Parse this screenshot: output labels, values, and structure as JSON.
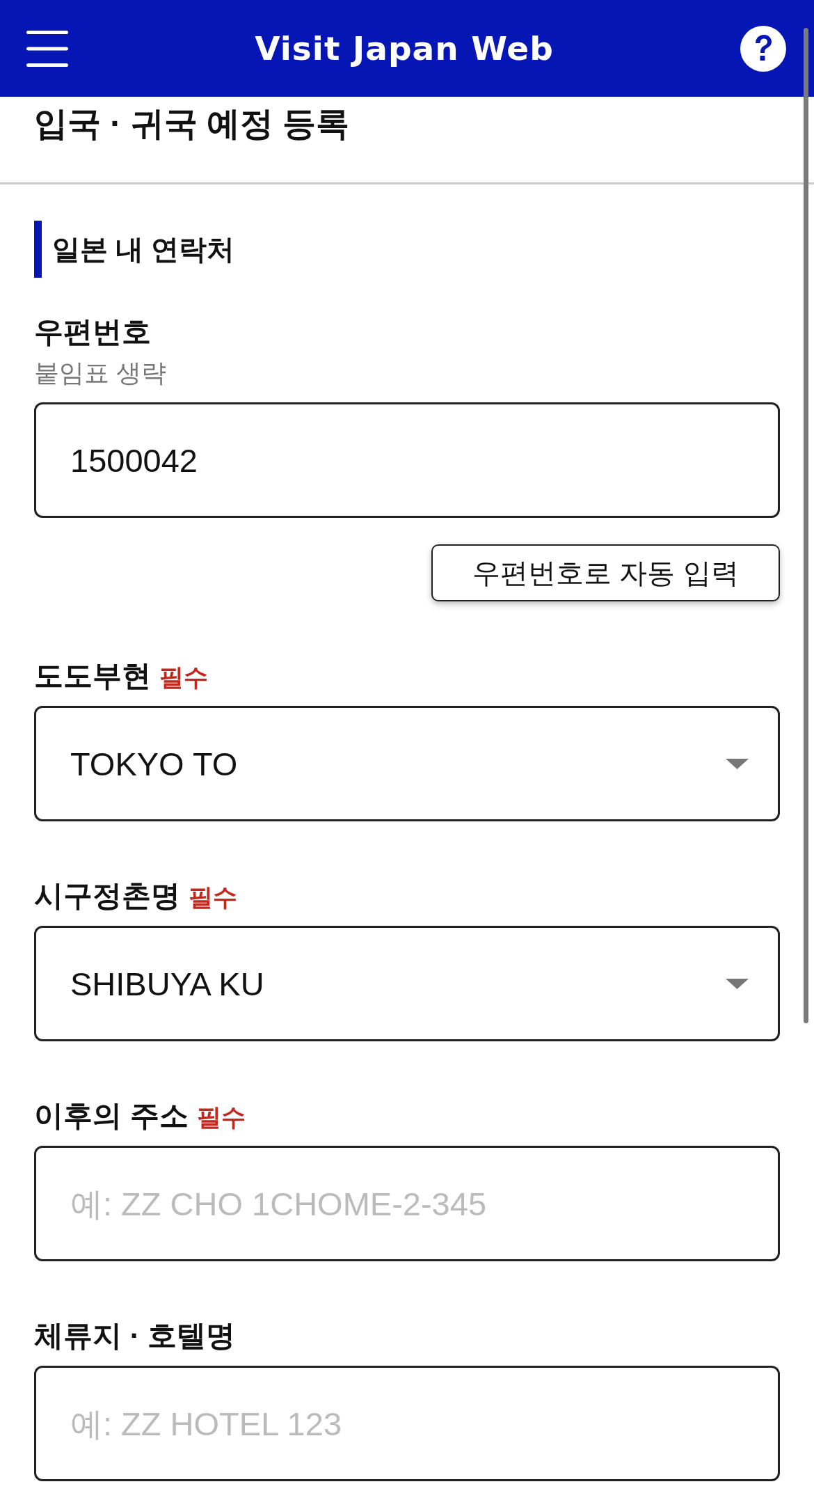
{
  "header": {
    "title": "Visit Japan Web"
  },
  "page_title": "입국 · 귀국 예정 등록",
  "section": {
    "title": "일본 내 연락처",
    "fields": [
      {
        "kind": "text",
        "label": "우편번호",
        "hint": "붙임표 생략",
        "value": "1500042",
        "action_button": "우편번호로 자동 입력"
      },
      {
        "kind": "select",
        "label": "도도부현",
        "required_label": "필수",
        "value": "TOKYO TO"
      },
      {
        "kind": "select",
        "label": "시구정촌명",
        "required_label": "필수",
        "value": "SHIBUYA KU"
      },
      {
        "kind": "text",
        "label": "이후의 주소",
        "required_label": "필수",
        "placeholder": "예: ZZ CHO 1CHOME-2-345"
      },
      {
        "kind": "text",
        "label": "체류지 · 호텔명",
        "placeholder": "예: ZZ HOTEL 123"
      }
    ]
  }
}
